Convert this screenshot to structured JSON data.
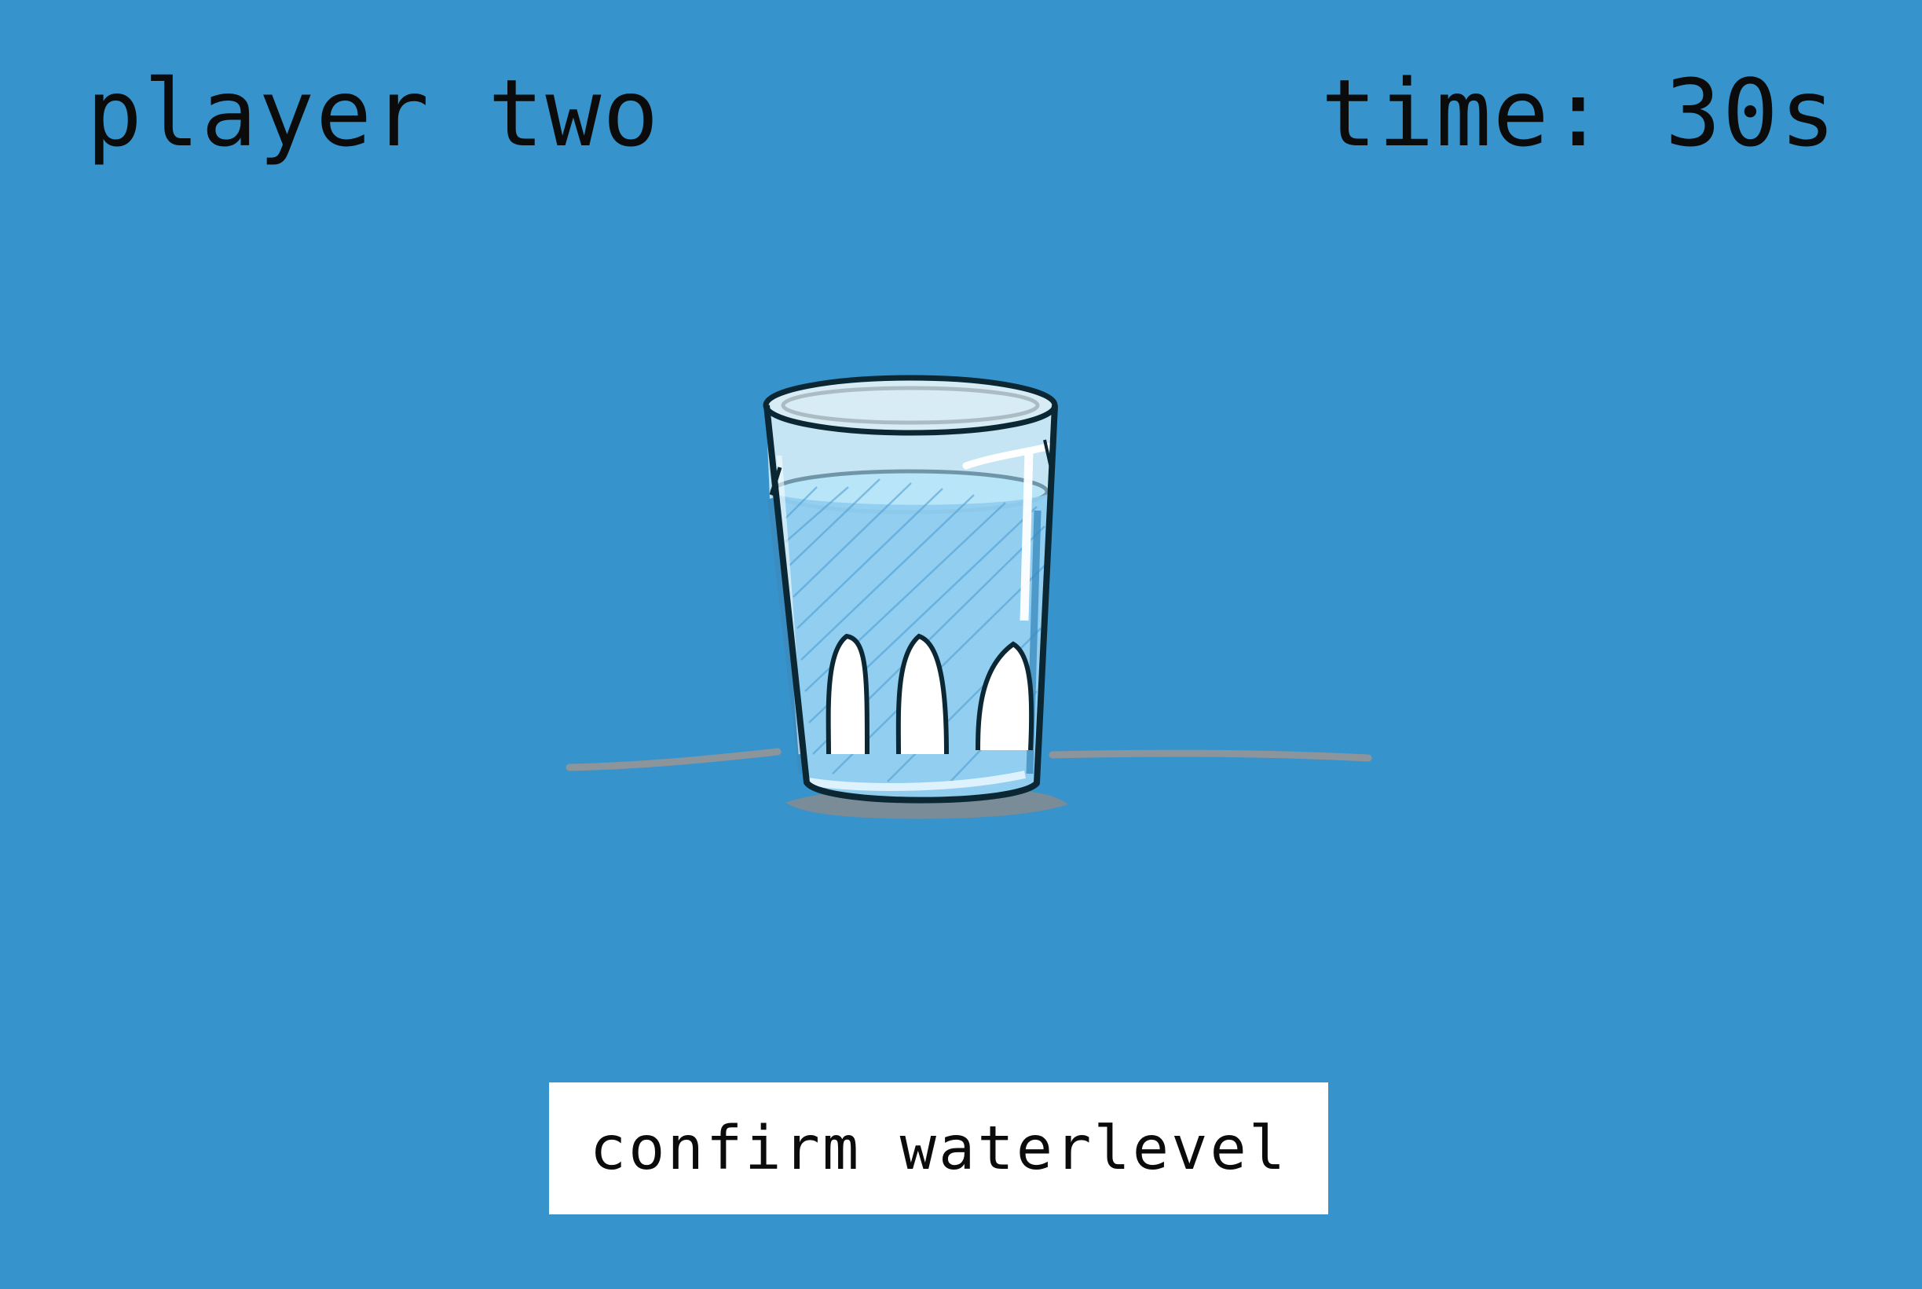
{
  "colors": {
    "background": "#3793cb",
    "text": "#0b0b0b",
    "button_background": "#ffffff",
    "water": "#a9d8f0",
    "glass_outline": "#0a2733",
    "table_line": "#8c959c"
  },
  "hud": {
    "player_label": "player two",
    "timer_label": "time: 30s"
  },
  "game": {
    "glass_icon": "water-glass-icon",
    "water_level_fraction": 0.78
  },
  "confirm_button": {
    "label": "confirm waterlevel"
  }
}
